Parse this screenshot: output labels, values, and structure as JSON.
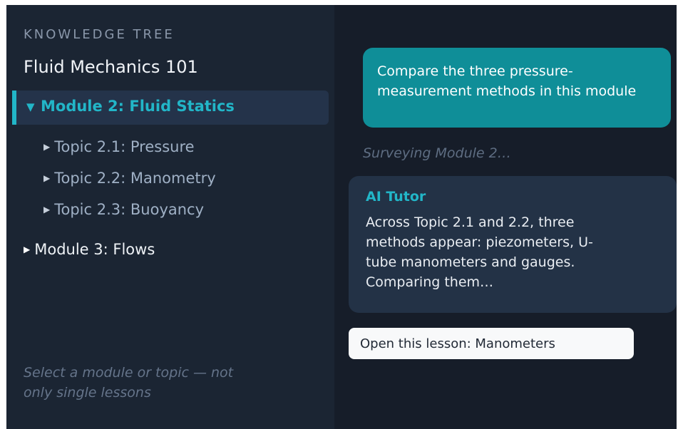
{
  "sidebar": {
    "heading": "KNOWLEDGE TREE",
    "course_title": "Fluid Mechanics 101",
    "modules": [
      {
        "caret": "▼",
        "label": "Module 2: Fluid Statics",
        "expanded": true,
        "selected": true,
        "topics": [
          {
            "caret": "▶",
            "label": "Topic 2.1: Pressure"
          },
          {
            "caret": "▶",
            "label": "Topic 2.2: Manometry"
          },
          {
            "caret": "▶",
            "label": "Topic 2.3: Buoyancy"
          }
        ]
      },
      {
        "caret": "▶",
        "label": "Module 3: Flows",
        "expanded": false,
        "selected": false
      }
    ],
    "hint": "Select a module or topic — not only single lessons"
  },
  "chat": {
    "user_message": "Compare the three pressure-measurement methods in this module",
    "status": "Surveying Module 2…",
    "ai_sender": "AI Tutor",
    "ai_message": "Across Topic 2.1 and 2.2, three methods appear: piezometers, U-tube manometers and gauges. Comparing them…",
    "lesson_button": "Open this lesson: Manometers"
  },
  "colors": {
    "sidebar_bg": "#1b2533",
    "chat_bg": "#161d29",
    "accent": "#22b6c8",
    "user_bubble": "#0f8e98",
    "ai_bubble": "#233246"
  }
}
